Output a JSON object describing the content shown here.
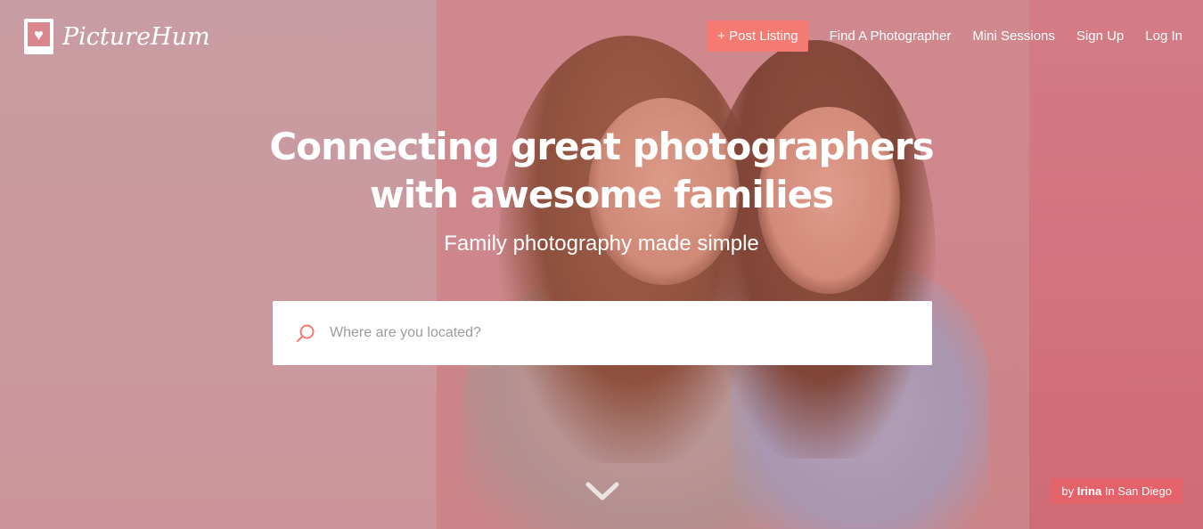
{
  "brand": {
    "name": "PictureHum",
    "accent_color": "#f57a72"
  },
  "nav": {
    "post_listing": "+ Post Listing",
    "find_photographer": "Find A Photographer",
    "mini_sessions": "Mini Sessions",
    "sign_up": "Sign Up",
    "log_in": "Log In"
  },
  "hero": {
    "title_line1": "Connecting great photographers",
    "title_line2": "with awesome families",
    "subtitle": "Family photography made simple"
  },
  "search": {
    "placeholder": "Where are you located?",
    "value": "",
    "icon": "search-icon"
  },
  "scroll": {
    "icon": "chevron-down-icon"
  },
  "credit": {
    "prefix": "by",
    "author": "Irina",
    "location": "In San Diego"
  }
}
